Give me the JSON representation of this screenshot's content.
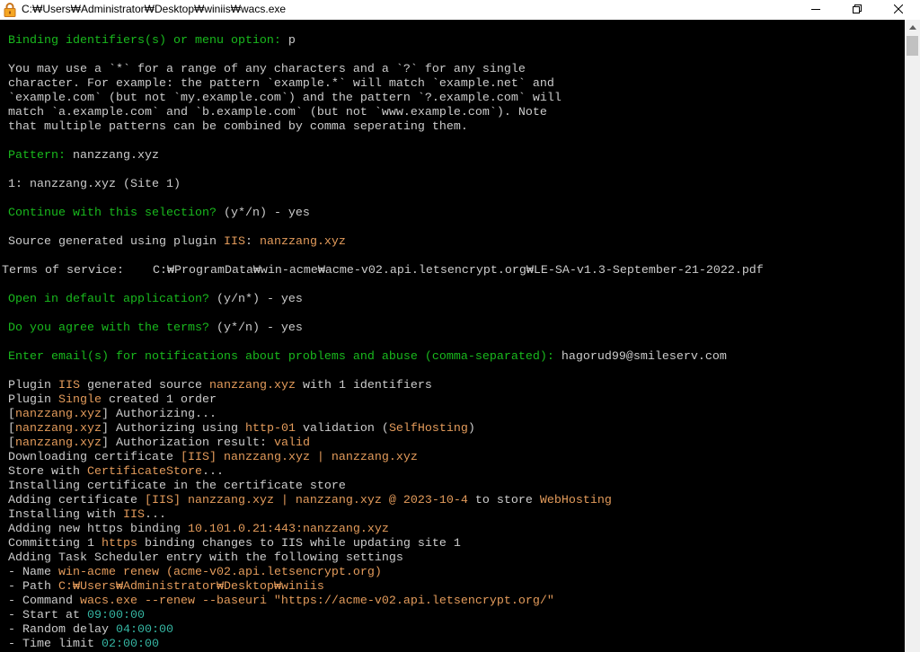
{
  "window": {
    "title": "C:₩Users₩Administrator₩Desktop₩winiis₩wacs.exe",
    "icon": "lock-icon",
    "controls": [
      "minimize-icon",
      "restore-icon",
      "close-icon"
    ]
  },
  "console": {
    "colors": {
      "background": "#000000",
      "text": "#cccccc",
      "prompt": "#19b91d",
      "value": "#e39b5b",
      "time": "#35b5a2"
    },
    "lines": [
      [
        {
          "t": "Binding identifiers(s) or menu option:",
          "c": "prompt"
        },
        {
          "t": " p"
        }
      ],
      [],
      [
        {
          "t": "You may use a `*` for a range of any characters and a `?` for any single"
        }
      ],
      [
        {
          "t": "character. For example: the pattern `example.*` will match `example.net` and"
        }
      ],
      [
        {
          "t": "`example.com` (but not `my.example.com`) and the pattern `?.example.com` will"
        }
      ],
      [
        {
          "t": "match `a.example.com` and `b.example.com` (but not `www.example.com`). Note"
        }
      ],
      [
        {
          "t": "that multiple patterns can be combined by comma seperating them."
        }
      ],
      [],
      [
        {
          "t": "Pattern:",
          "c": "prompt"
        },
        {
          "t": " nanzzang.xyz"
        }
      ],
      [],
      [
        {
          "t": "1: nanzzang.xyz (Site 1)"
        }
      ],
      [],
      [
        {
          "t": "Continue with this selection?",
          "c": "prompt"
        },
        {
          "t": " (y*/n) - yes"
        }
      ],
      [],
      [
        {
          "t": "Source generated using plugin "
        },
        {
          "t": "IIS",
          "c": "value"
        },
        {
          "t": ": "
        },
        {
          "t": "nanzzang.xyz",
          "c": "value"
        }
      ],
      [],
      [
        {
          "t": "Terms of service:    C:₩ProgramData₩win-acme₩acme-v02.api.letsencrypt.org₩LE-SA-v1.3-September-21-2022.pdf"
        }
      ],
      [],
      [
        {
          "t": "Open in default application?",
          "c": "prompt"
        },
        {
          "t": " (y/n*) - yes"
        }
      ],
      [],
      [
        {
          "t": "Do you agree with the terms?",
          "c": "prompt"
        },
        {
          "t": " (y*/n) - yes"
        }
      ],
      [],
      [
        {
          "t": "Enter email(s) for notifications about problems and abuse (comma-separated):",
          "c": "prompt"
        },
        {
          "t": " hagorud99@smileserv.com"
        }
      ],
      [],
      [
        {
          "t": "Plugin "
        },
        {
          "t": "IIS",
          "c": "value"
        },
        {
          "t": " generated source "
        },
        {
          "t": "nanzzang.xyz",
          "c": "value"
        },
        {
          "t": " with 1 identifiers"
        }
      ],
      [
        {
          "t": "Plugin "
        },
        {
          "t": "Single",
          "c": "value"
        },
        {
          "t": " created 1 order"
        }
      ],
      [
        {
          "t": "["
        },
        {
          "t": "nanzzang.xyz",
          "c": "value"
        },
        {
          "t": "] Authorizing..."
        }
      ],
      [
        {
          "t": "["
        },
        {
          "t": "nanzzang.xyz",
          "c": "value"
        },
        {
          "t": "] Authorizing using "
        },
        {
          "t": "http-01",
          "c": "value"
        },
        {
          "t": " validation ("
        },
        {
          "t": "SelfHosting",
          "c": "value"
        },
        {
          "t": ")"
        }
      ],
      [
        {
          "t": "["
        },
        {
          "t": "nanzzang.xyz",
          "c": "value"
        },
        {
          "t": "] Authorization result: "
        },
        {
          "t": "valid",
          "c": "value"
        }
      ],
      [
        {
          "t": "Downloading certificate "
        },
        {
          "t": "[IIS] nanzzang.xyz | nanzzang.xyz",
          "c": "value"
        }
      ],
      [
        {
          "t": "Store with "
        },
        {
          "t": "CertificateStore",
          "c": "value"
        },
        {
          "t": "..."
        }
      ],
      [
        {
          "t": "Installing certificate in the certificate store"
        }
      ],
      [
        {
          "t": "Adding certificate "
        },
        {
          "t": "[IIS] nanzzang.xyz | nanzzang.xyz @ 2023-10-4",
          "c": "value"
        },
        {
          "t": " to store "
        },
        {
          "t": "WebHosting",
          "c": "value"
        }
      ],
      [
        {
          "t": "Installing with "
        },
        {
          "t": "IIS",
          "c": "value"
        },
        {
          "t": "..."
        }
      ],
      [
        {
          "t": "Adding new https binding "
        },
        {
          "t": "10.101.0.21:443:nanzzang.xyz",
          "c": "value"
        }
      ],
      [
        {
          "t": "Committing 1 "
        },
        {
          "t": "https",
          "c": "value"
        },
        {
          "t": " binding changes to IIS while updating site 1"
        }
      ],
      [
        {
          "t": "Adding Task Scheduler entry with the following settings"
        }
      ],
      [
        {
          "t": "- Name "
        },
        {
          "t": "win-acme renew (acme-v02.api.letsencrypt.org)",
          "c": "value"
        }
      ],
      [
        {
          "t": "- Path "
        },
        {
          "t": "C:₩Users₩Administrator₩Desktop₩winiis",
          "c": "value"
        }
      ],
      [
        {
          "t": "- Command "
        },
        {
          "t": "wacs.exe --renew --baseuri \"https://acme-v02.api.letsencrypt.org/\"",
          "c": "value"
        }
      ],
      [
        {
          "t": "- Start at "
        },
        {
          "t": "09:00:00",
          "c": "time"
        }
      ],
      [
        {
          "t": "- Random delay "
        },
        {
          "t": "04:00:00",
          "c": "time"
        }
      ],
      [
        {
          "t": "- Time limit "
        },
        {
          "t": "02:00:00",
          "c": "time"
        }
      ]
    ]
  },
  "scrollbar": {
    "up_icon": "arrow-up-icon",
    "scroll_fraction": 0
  }
}
